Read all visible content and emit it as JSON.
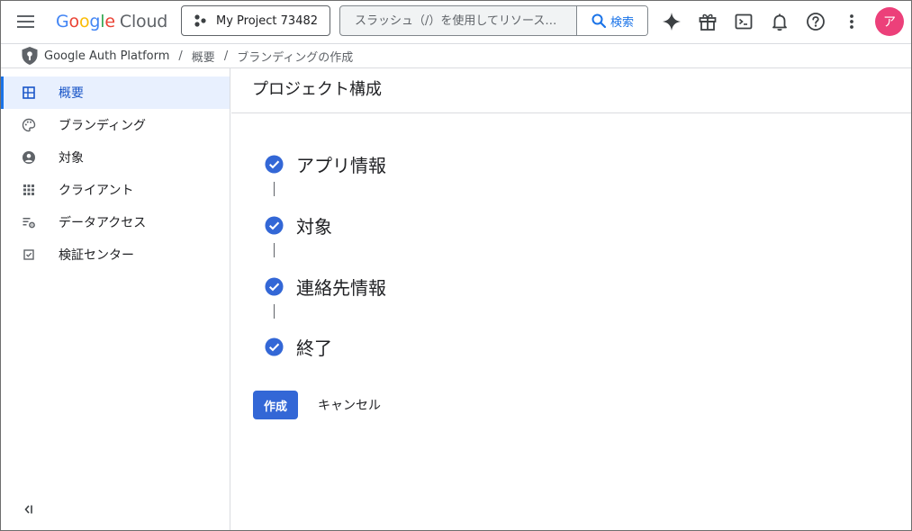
{
  "header": {
    "logo": {
      "google": "Google",
      "cloud": "Cloud"
    },
    "project_picker": {
      "label": "My Project 73482"
    },
    "search": {
      "placeholder": "スラッシュ（/）を使用してリソース…",
      "button_label": "検索"
    },
    "icons": [
      "gemini-icon",
      "gift-icon",
      "cloud-shell-icon",
      "notifications-icon",
      "help-icon",
      "more-vert-icon"
    ],
    "avatar": {
      "initial": "ア",
      "color": "#ec407a"
    }
  },
  "breadcrumb": {
    "items": [
      "Google Auth Platform",
      "概要",
      "ブランディングの作成"
    ],
    "separator": "/"
  },
  "sidebar": {
    "items": [
      {
        "label": "概要",
        "icon": "dashboard-icon",
        "active": true
      },
      {
        "label": "ブランディング",
        "icon": "palette-icon",
        "active": false
      },
      {
        "label": "対象",
        "icon": "account-circle-icon",
        "active": false
      },
      {
        "label": "クライアント",
        "icon": "apps-icon",
        "active": false
      },
      {
        "label": "データアクセス",
        "icon": "list-settings-icon",
        "active": false
      },
      {
        "label": "検証センター",
        "icon": "checkbox-icon",
        "active": false
      }
    ],
    "collapse_icon": "collapse-sidebar-icon"
  },
  "main": {
    "title": "プロジェクト構成",
    "steps": [
      {
        "label": "アプリ情報",
        "status": "complete"
      },
      {
        "label": "対象",
        "status": "complete"
      },
      {
        "label": "連絡先情報",
        "status": "complete"
      },
      {
        "label": "終了",
        "status": "complete"
      }
    ],
    "create_button": "作成",
    "cancel_button": "キャンセル"
  },
  "colors": {
    "accent": "#1a73e8",
    "check": "#3367d6",
    "active_nav_bg": "#e8f0fe"
  }
}
